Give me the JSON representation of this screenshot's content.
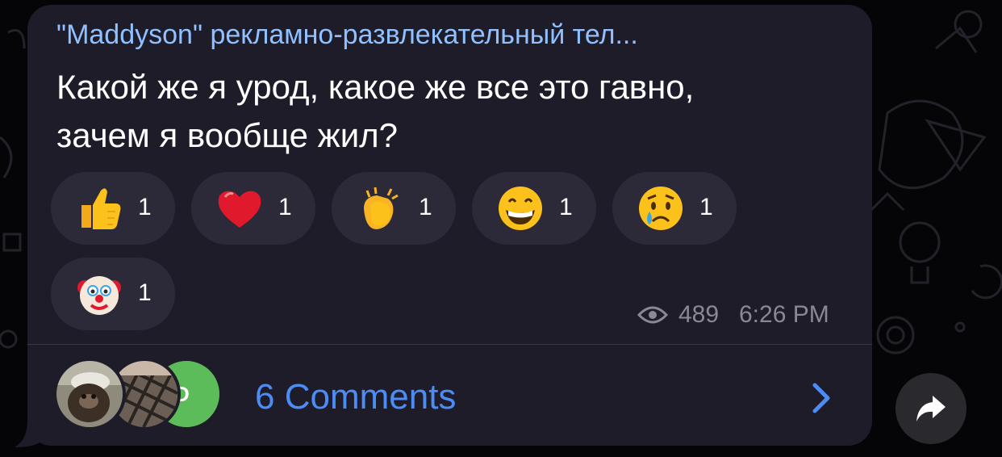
{
  "message": {
    "channel_name": "\"Maddyson\" рекламно-развлекательный тел...",
    "text_line1": "Какой же я урод, какое же все это гавно,",
    "text_line2": "зачем я вообще жил?",
    "views": "489",
    "time": "6:26 PM"
  },
  "reactions": [
    {
      "emoji": "thumbs-up",
      "count": "1"
    },
    {
      "emoji": "red-heart",
      "count": "1"
    },
    {
      "emoji": "clapping-hands",
      "count": "1"
    },
    {
      "emoji": "grinning-face",
      "count": "1"
    },
    {
      "emoji": "crying-face",
      "count": "1"
    },
    {
      "emoji": "clown-face",
      "count": "1"
    }
  ],
  "comments": {
    "label": "6 Comments",
    "avatars": [
      {
        "type": "photo-monkey"
      },
      {
        "type": "photo-plaid"
      },
      {
        "type": "initial",
        "initial": "D",
        "color": "#5dbc5a"
      }
    ]
  },
  "colors": {
    "bubble": "#1f1c2a",
    "channel_name": "#8fc0ff",
    "link": "#4c8cf5",
    "meta": "#8a8894"
  }
}
